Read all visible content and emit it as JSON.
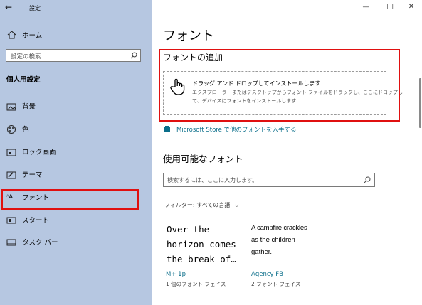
{
  "window": {
    "title": "設定",
    "minimize": "—",
    "maximize": "☐",
    "close": "✕",
    "back": "←"
  },
  "sidebar": {
    "home": "ホーム",
    "search_placeholder": "設定の検索",
    "section": "個人用設定",
    "items": [
      {
        "label": "背景",
        "icon": "picture-icon"
      },
      {
        "label": "色",
        "icon": "palette-icon"
      },
      {
        "label": "ロック画面",
        "icon": "lock-screen-icon"
      },
      {
        "label": "テーマ",
        "icon": "theme-icon"
      },
      {
        "label": "フォント",
        "icon": "font-icon"
      },
      {
        "label": "スタート",
        "icon": "start-icon"
      },
      {
        "label": "タスク バー",
        "icon": "taskbar-icon"
      }
    ]
  },
  "main": {
    "title": "フォント",
    "add_heading": "フォントの追加",
    "drop_title": "ドラッグ アンド ドロップしてインストールします",
    "drop_desc_1": "エクスプローラーまたはデスクトップからフォント ファイルをドラッグし、ここにドロップし",
    "drop_desc_2": "て、デバイスにフォントをインストールします",
    "store_link": "Microsoft Store で他のフォントを入手する",
    "available_heading": "使用可能なフォント",
    "search_placeholder": "検索するには、ここに入力します。",
    "filter_label": "フィルター: ",
    "filter_value": "すべての言語",
    "fonts": [
      {
        "sample_1": "Over the",
        "sample_2": "horizon comes",
        "sample_3": "the break of…",
        "name": "M+ 1p",
        "faces": "1 個のフォント フェイス"
      },
      {
        "sample_1": "A campfire crackles",
        "sample_2": "as the children",
        "sample_3": "gather.",
        "name": "Agency FB",
        "faces": "2 フォント フェイス"
      }
    ]
  },
  "colors": {
    "sidebar_bg": "#b6c7e1",
    "accent": "#0a6e8a",
    "highlight": "#e01010"
  }
}
